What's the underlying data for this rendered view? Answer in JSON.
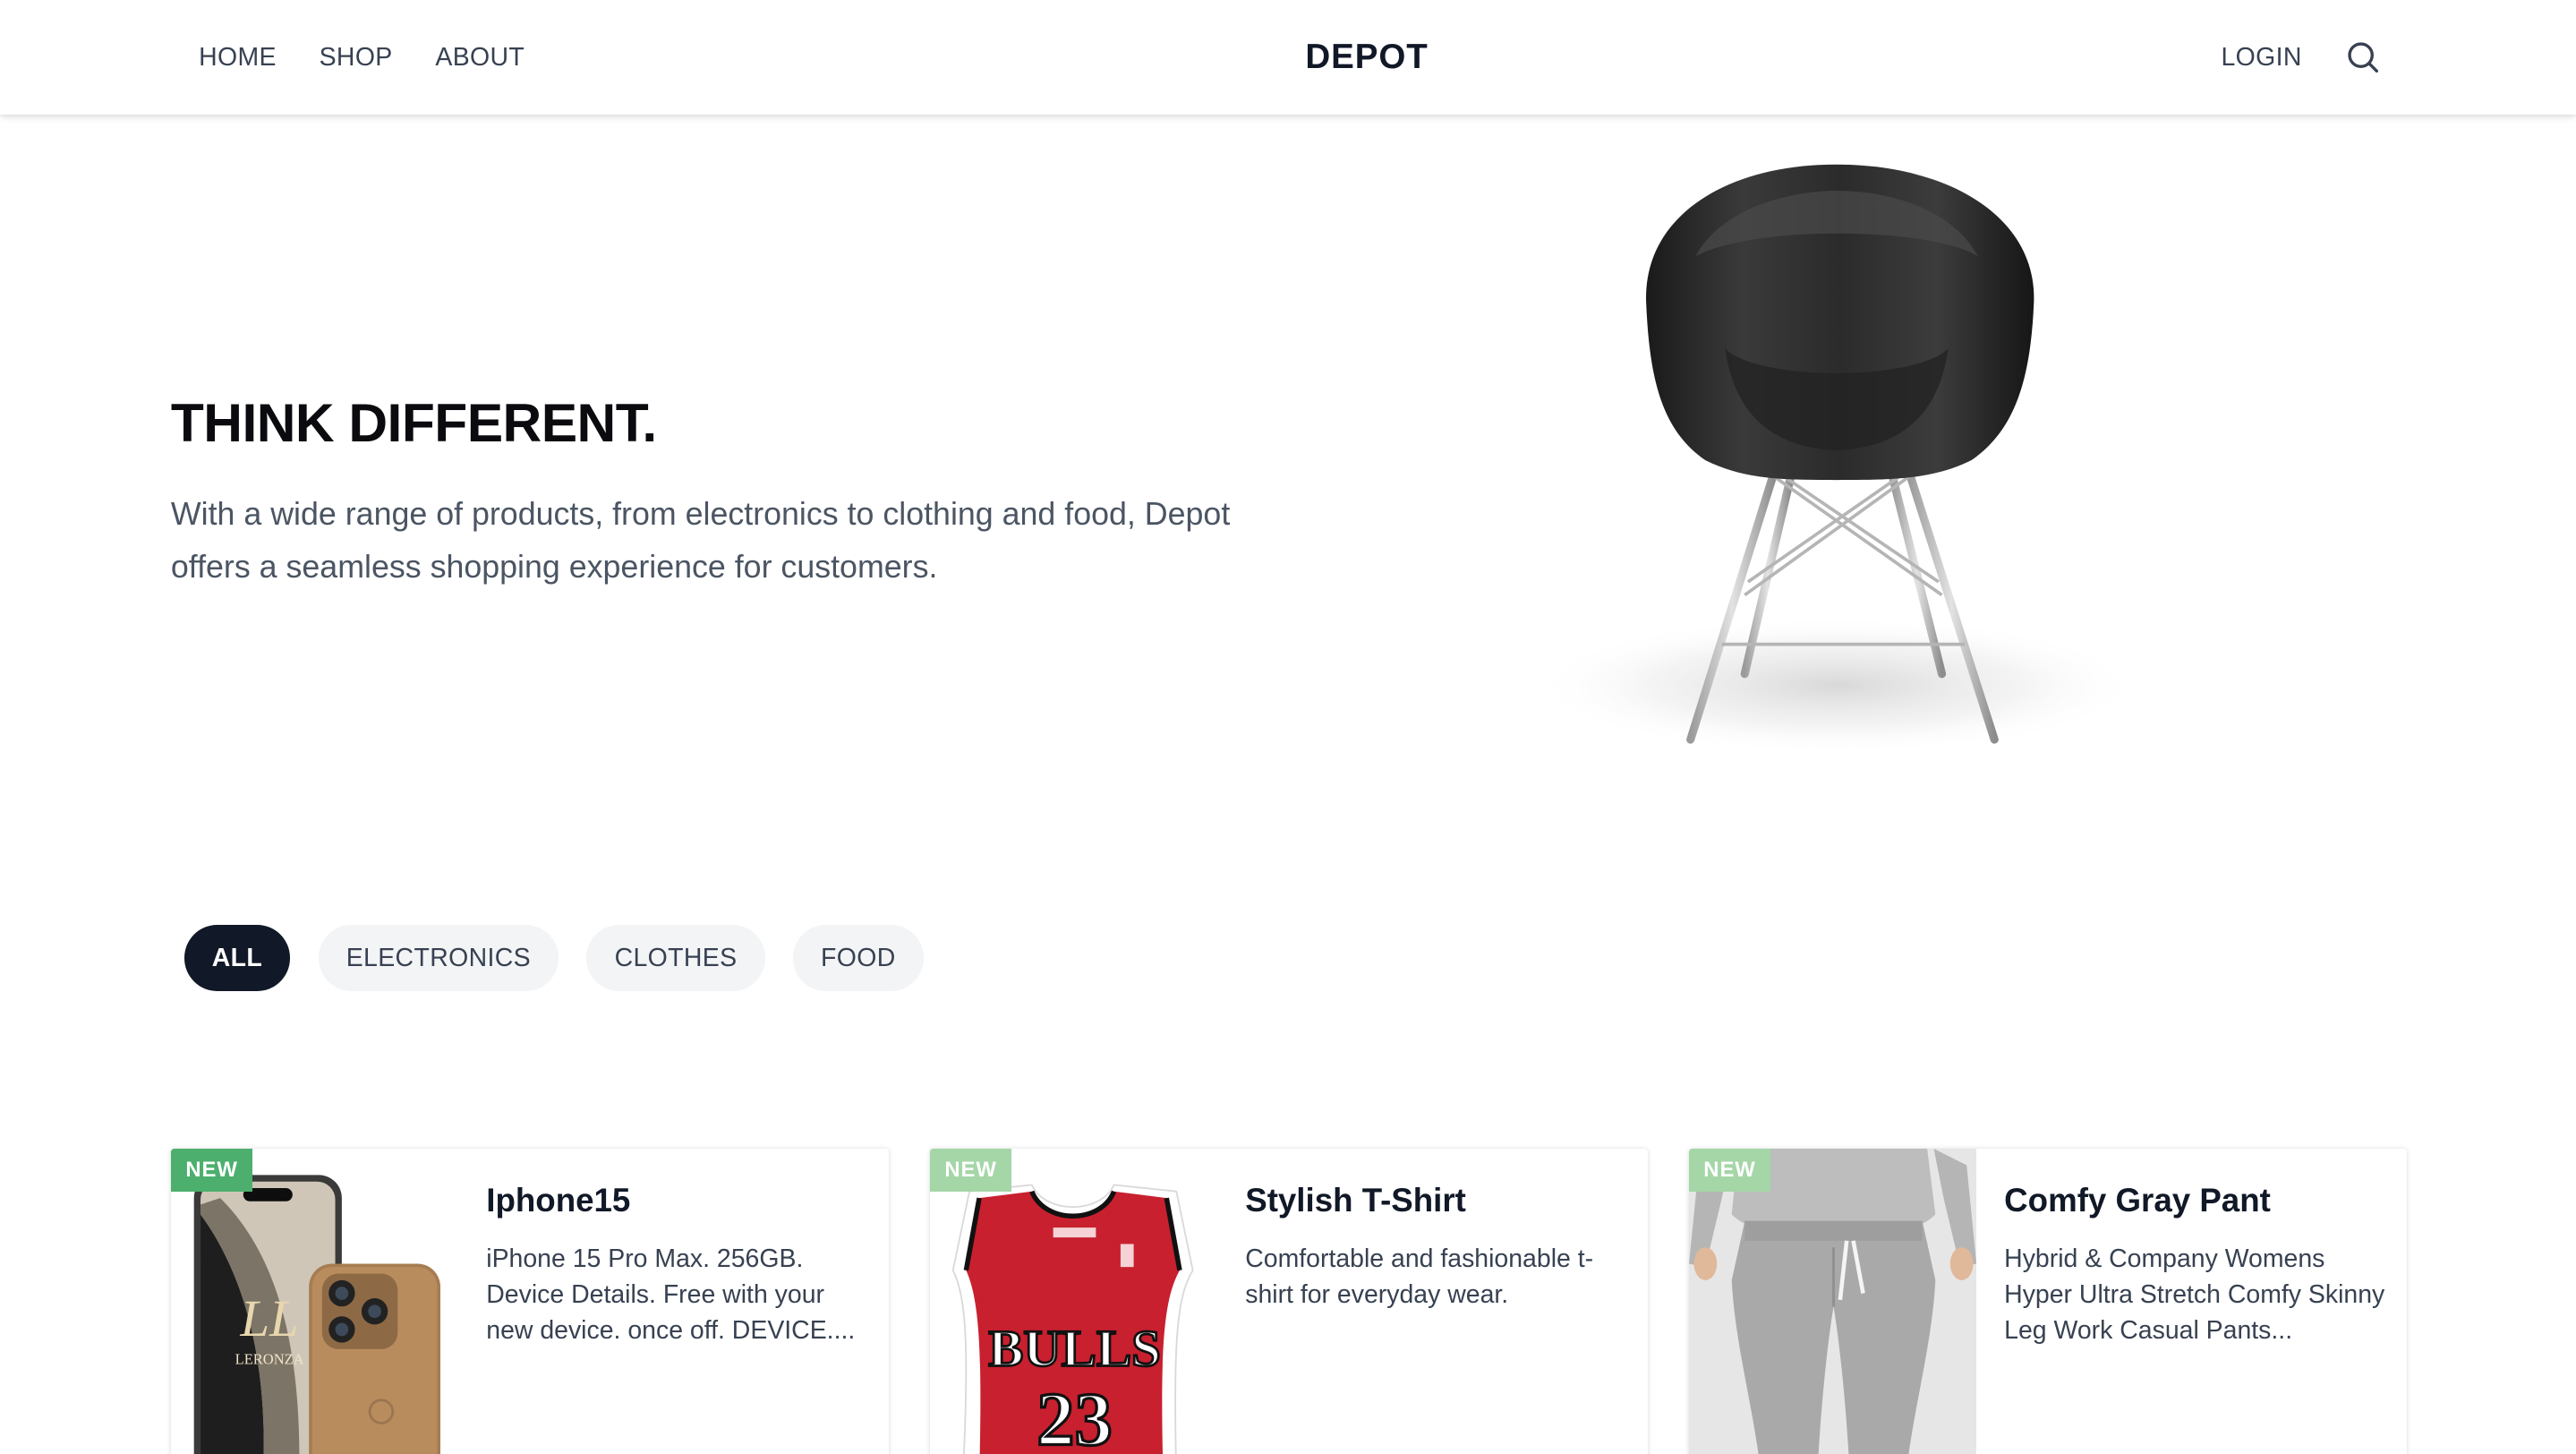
{
  "nav": {
    "links": [
      "HOME",
      "SHOP",
      "ABOUT"
    ],
    "brand": "DEPOT",
    "login": "LOGIN",
    "search_icon": "search-icon"
  },
  "hero": {
    "title": "THINK DIFFERENT.",
    "text": "With a wide range of products, from electronics to clothing and food, Depot offers a seamless shopping experience for customers.",
    "image": "black-armchair-photo"
  },
  "filters": {
    "options": [
      "ALL",
      "ELECTRONICS",
      "CLOTHES",
      "FOOD"
    ],
    "selected": "ALL"
  },
  "products": [
    {
      "badge": "NEW",
      "title": "Iphone15",
      "description": "iPhone 15 Pro Max. 256GB. Device Details. Free with your new device. once off. DEVICE....",
      "image": "iphone-gold-photo",
      "image_text": "LERONZA"
    },
    {
      "badge": "NEW",
      "title": "Stylish T-Shirt",
      "description": "Comfortable and fashionable t-shirt for everyday wear.",
      "image": "bulls-jersey-photo",
      "image_text": [
        "BULLS",
        "23"
      ]
    },
    {
      "badge": "NEW",
      "title": "Comfy Gray Pant",
      "description": "Hybrid & Company Womens Hyper Ultra Stretch Comfy Skinny Leg Work Casual Pants...",
      "image": "gray-pants-photo"
    }
  ],
  "colors": {
    "badge_strong": "#4caf6e",
    "badge_light": "#a5d6a7",
    "active_pill": "#111827",
    "pill": "#f3f4f6"
  }
}
